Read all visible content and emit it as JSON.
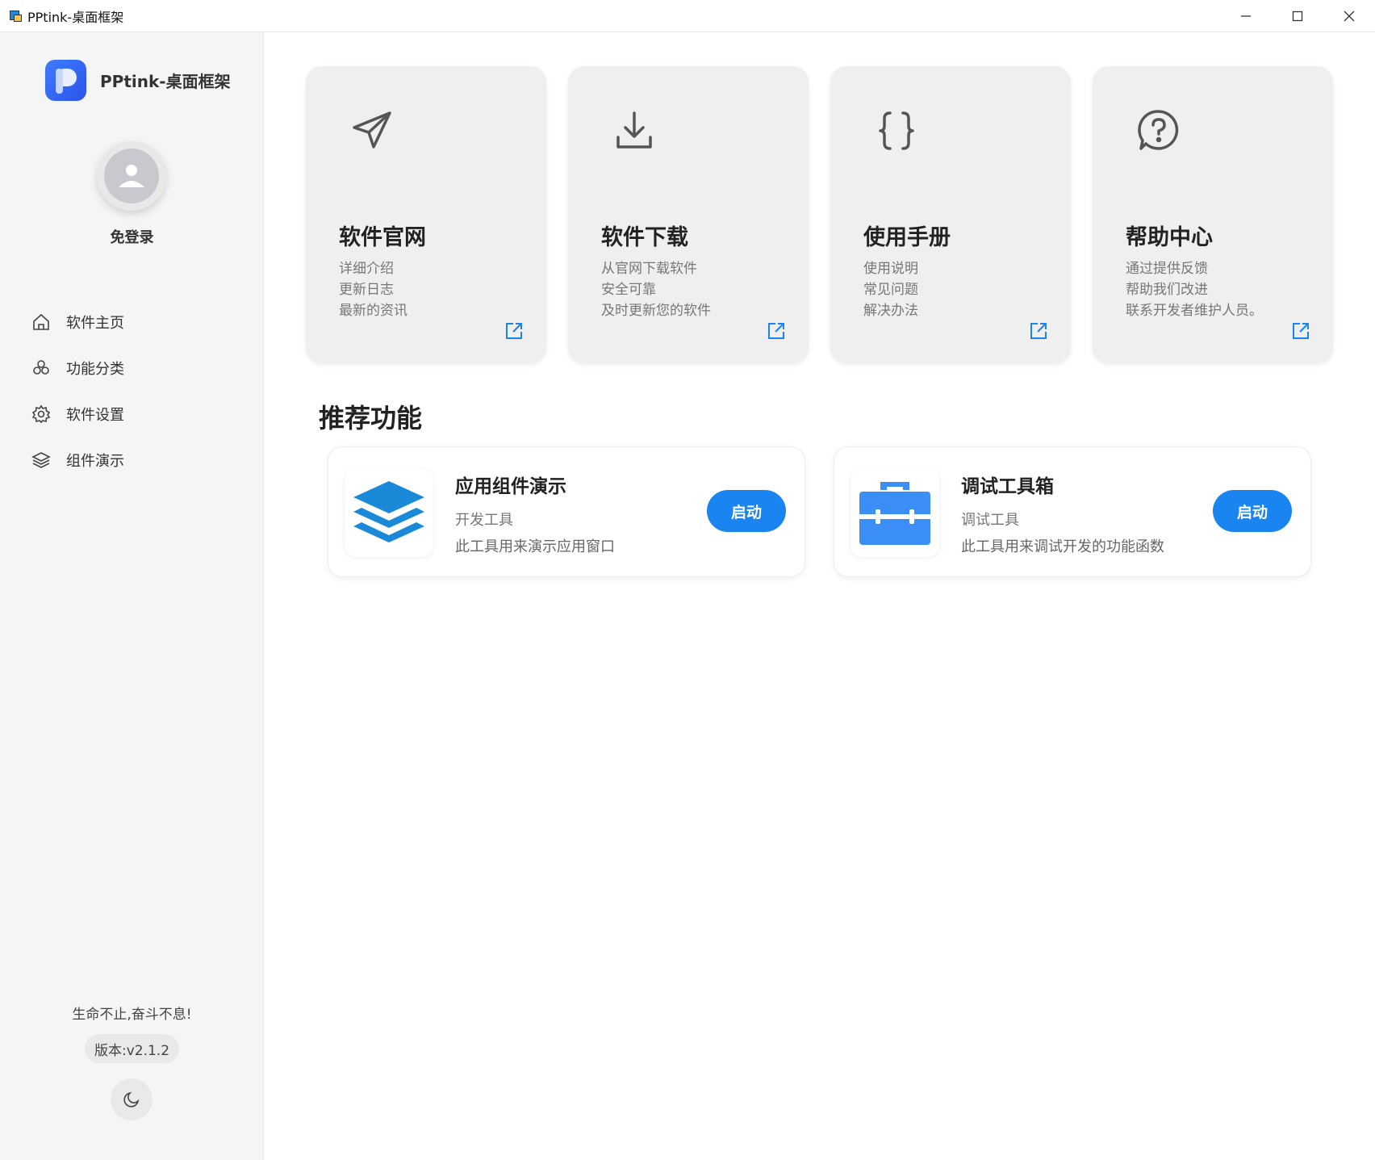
{
  "window": {
    "title": "PPtink-桌面框架",
    "controls": [
      "minimize-icon",
      "maximize-icon",
      "close-icon"
    ]
  },
  "sidebar": {
    "brand": "PPtink-桌面框架",
    "login_label": "免登录",
    "items": [
      {
        "label": "软件主页",
        "icon": "home-icon"
      },
      {
        "label": "功能分类",
        "icon": "category-icon"
      },
      {
        "label": "软件设置",
        "icon": "gear-icon"
      },
      {
        "label": "组件演示",
        "icon": "layers-icon"
      }
    ],
    "motto": "生命不止,奋斗不息!",
    "version": "版本:v2.1.2",
    "theme_icon": "moon-icon"
  },
  "cards": [
    {
      "title": "软件官网",
      "icon": "send-icon",
      "lines": [
        "详细介绍",
        "更新日志",
        "最新的资讯"
      ]
    },
    {
      "title": "软件下载",
      "icon": "download-icon",
      "lines": [
        "从官网下载软件",
        "安全可靠",
        "及时更新您的软件"
      ]
    },
    {
      "title": "使用手册",
      "icon": "braces-icon",
      "lines": [
        "使用说明",
        "常见问题",
        "解决办法"
      ]
    },
    {
      "title": "帮助中心",
      "icon": "help-icon",
      "lines": [
        "通过提供反馈",
        "帮助我们改进",
        "联系开发者维护人员。"
      ]
    }
  ],
  "recommend": {
    "title": "推荐功能",
    "items": [
      {
        "title": "应用组件演示",
        "subtitle": "开发工具",
        "desc": "此工具用来演示应用窗口",
        "button": "启动",
        "icon": "layers-app-icon"
      },
      {
        "title": "调试工具箱",
        "subtitle": "调试工具",
        "desc": "此工具用来调试开发的功能函数",
        "button": "启动",
        "icon": "toolbox-icon"
      }
    ]
  },
  "colors": {
    "accent": "#1a84f0",
    "card_bg": "#efefef",
    "sidebar_bg": "#f5f5f5"
  }
}
